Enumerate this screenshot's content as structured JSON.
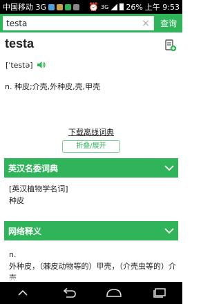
{
  "status_bar": {
    "carrier": "中国移动 3G",
    "battery": "26%",
    "time": "上午 9:53",
    "network": "3G"
  },
  "search": {
    "value": "testa",
    "button_label": "查询"
  },
  "entry": {
    "word": "testa",
    "phonetic": "[ˈtestə]",
    "definition": "n. 种皮;介壳,外种皮,壳,甲壳"
  },
  "actions": {
    "download_label": "下载离线词典",
    "fold_label": "折叠/展开"
  },
  "sections": {
    "dict": {
      "title": "英汉名委词典",
      "line1": "[英汉植物学名词]",
      "line2": "种皮"
    },
    "web": {
      "title": "网络释义",
      "pos": "n.",
      "line1": "外种皮，（棘皮动物等的）甲壳，（介壳虫等的）介壳"
    }
  },
  "colors": {
    "accent": "#2fb45a"
  }
}
